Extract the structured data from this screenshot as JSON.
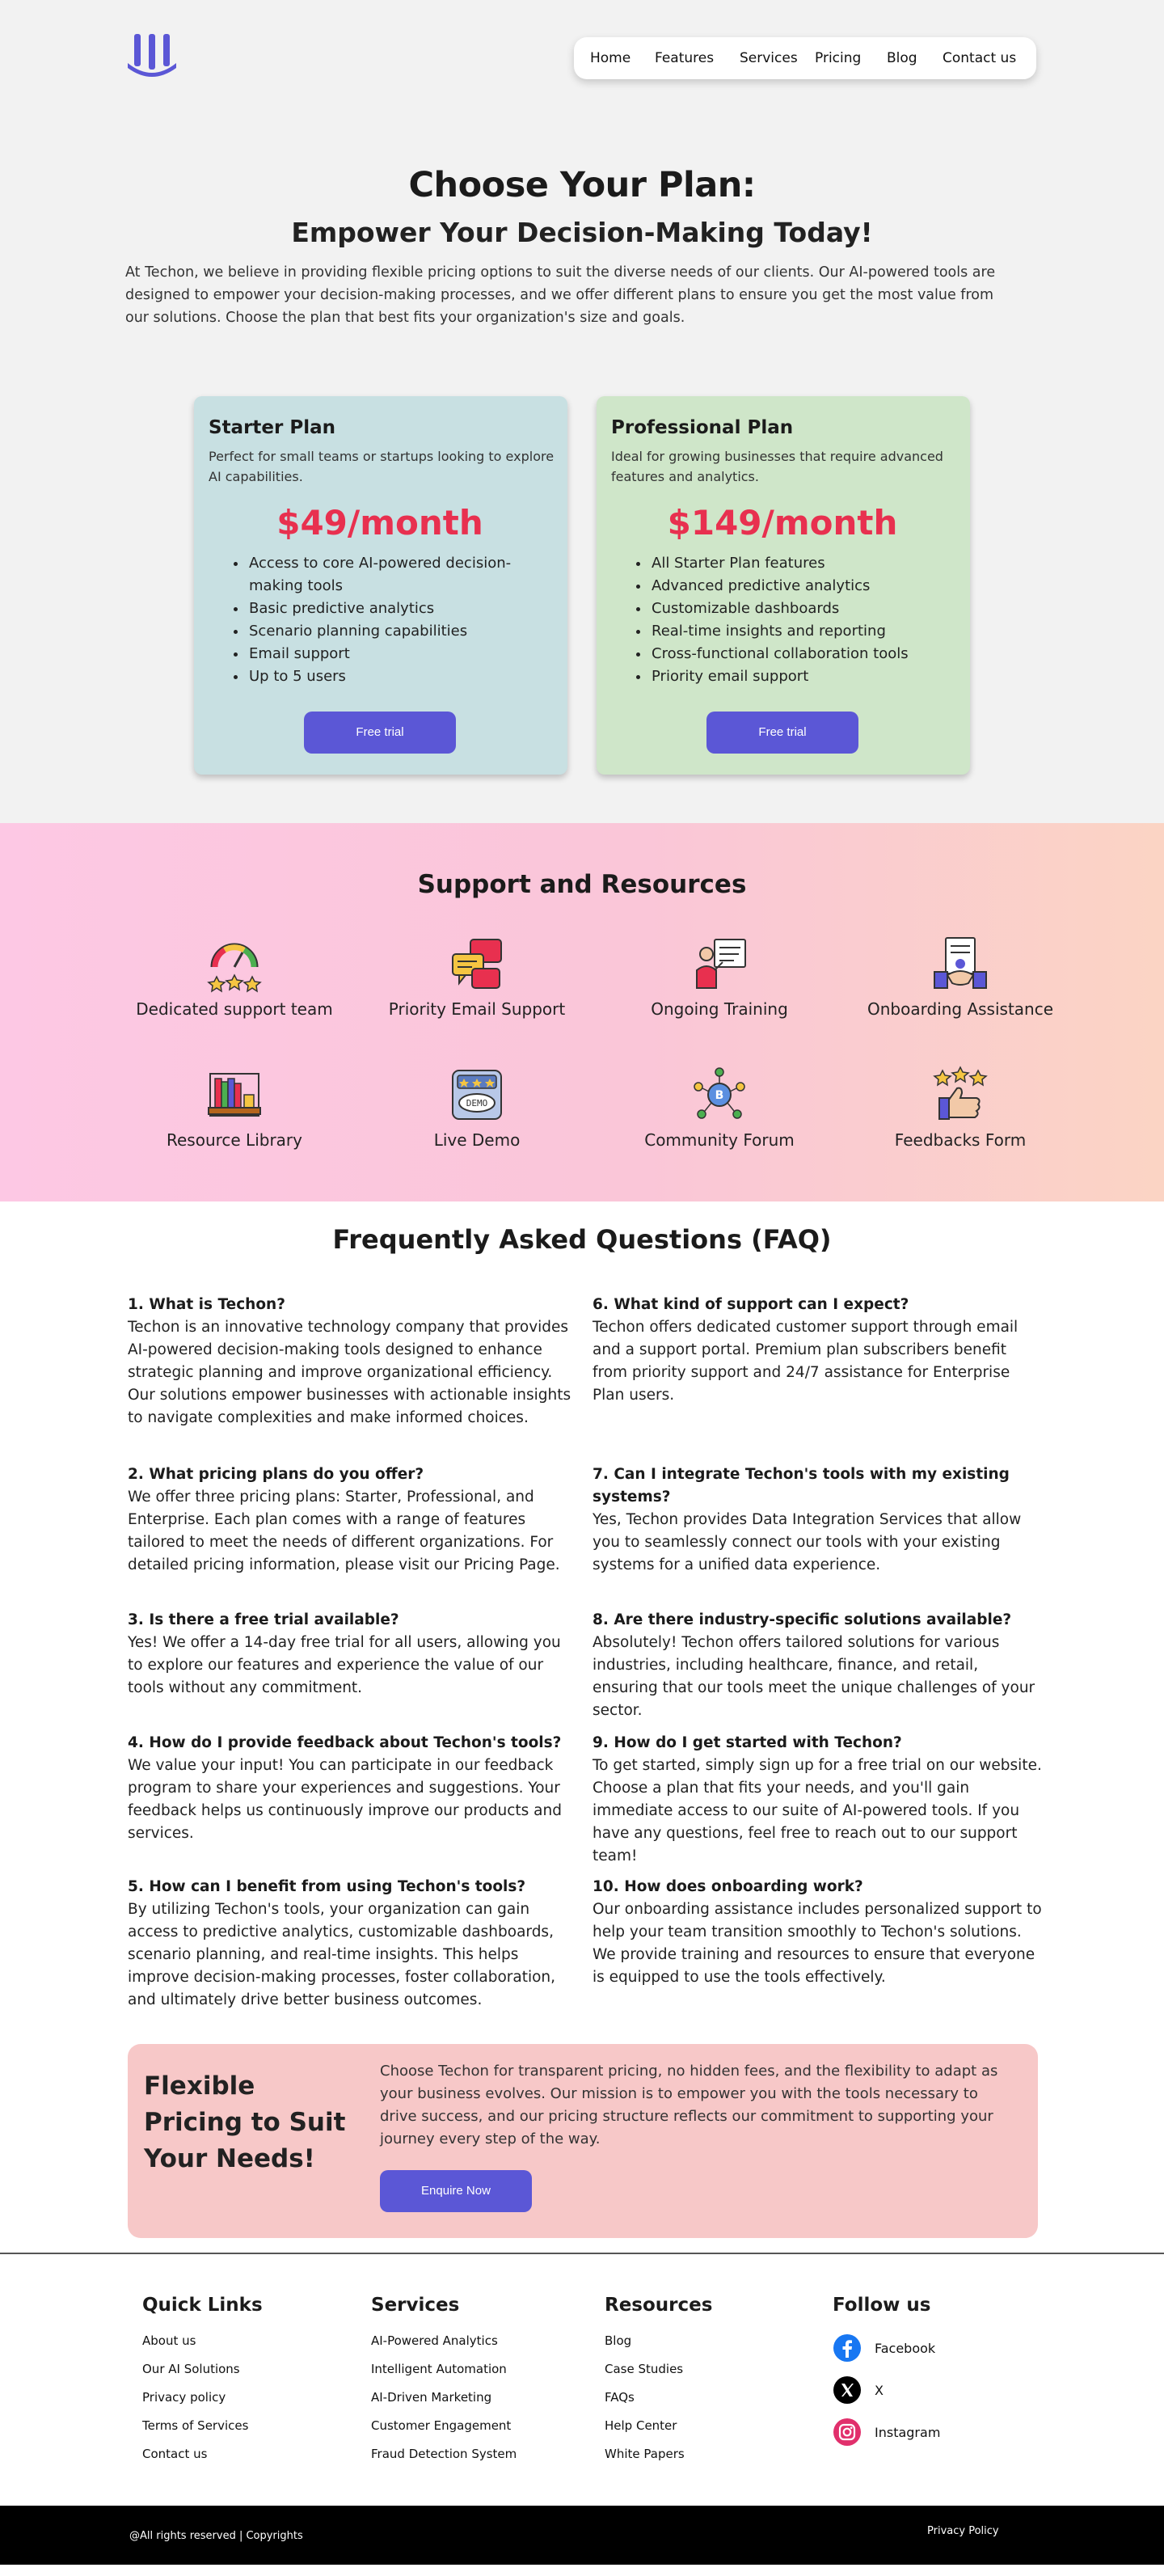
{
  "nav": [
    "Home",
    "Features",
    "Services",
    "Pricing",
    "Blog",
    "Contact us"
  ],
  "hero": {
    "title": "Choose Your Plan:",
    "subtitle": "Empower Your Decision-Making Today!",
    "intro": "At Techon, we believe in providing flexible pricing options to suit the diverse needs of our clients. Our AI-powered tools are designed to empower your decision-making processes, and we offer different plans to ensure you get the most value from our solutions. Choose the plan that best fits your organization's size and goals."
  },
  "plans": [
    {
      "name": "Starter Plan",
      "description": "Perfect for small teams or startups looking to explore AI capabilities.",
      "price": "$49/month",
      "features": [
        "Access to core AI-powered decision-making tools",
        "Basic predictive analytics",
        "Scenario planning capabilities",
        "Email support",
        "Up to 5 users"
      ],
      "button": "Free trial",
      "color": "#c8e0e2"
    },
    {
      "name": "Professional Plan",
      "description": "Ideal for growing businesses that require advanced features and analytics.",
      "price": "$149/month",
      "features": [
        "All Starter Plan features",
        "Advanced predictive analytics",
        "Customizable dashboards",
        "Real-time insights and reporting",
        "Cross-functional collaboration tools",
        "Priority email support"
      ],
      "button": "Free trial",
      "color": "#cfe6c9"
    }
  ],
  "support": {
    "title": "Support and Resources",
    "items": [
      {
        "label": "Dedicated support team",
        "icon": "gauge-stars-icon"
      },
      {
        "label": "Priority Email Support",
        "icon": "chat-bubbles-icon"
      },
      {
        "label": "Ongoing Training",
        "icon": "trainer-board-icon"
      },
      {
        "label": "Onboarding Assistance",
        "icon": "handshake-document-icon"
      },
      {
        "label": "Resource Library",
        "icon": "bookshelf-icon"
      },
      {
        "label": "Live Demo",
        "icon": "demo-screen-icon"
      },
      {
        "label": "Community Forum",
        "icon": "community-network-icon"
      },
      {
        "label": "Feedbacks Form",
        "icon": "thumbs-up-stars-icon"
      }
    ]
  },
  "faq": {
    "title": "Frequently Asked Questions (FAQ)",
    "items": [
      {
        "q": "1. What is Techon?",
        "a": "Techon is an innovative technology company that provides AI-powered decision-making tools designed to enhance strategic planning and improve organizational efficiency. Our solutions empower businesses with actionable insights to navigate complexities and make informed choices."
      },
      {
        "q": "2. What pricing plans do you offer?",
        "a": "We offer three pricing plans: Starter, Professional, and Enterprise. Each plan comes with a range of features tailored to meet the needs of different organizations. For detailed pricing information, please visit our Pricing Page."
      },
      {
        "q": "3. Is there a free trial available?",
        "a": "Yes! We offer a 14-day free trial for all users, allowing you to explore our features and experience the value of our tools without any commitment."
      },
      {
        "q": "4. How do I provide feedback about Techon's tools?",
        "a": "We value your input! You can participate in our feedback program to share your experiences and suggestions. Your feedback helps us continuously improve our products and services."
      },
      {
        "q": "5. How can I benefit from using Techon's tools?",
        "a": "By utilizing Techon's tools, your organization can gain access to predictive analytics, customizable dashboards, scenario planning, and real-time insights. This helps improve decision-making processes, foster collaboration, and ultimately drive better business outcomes."
      },
      {
        "q": "6. What kind of support can I expect?",
        "a": "Techon offers dedicated customer support through email and a support portal. Premium plan subscribers benefit from priority support and 24/7 assistance for Enterprise Plan users."
      },
      {
        "q": "7. Can I integrate Techon's tools with my existing systems?",
        "a": "Yes, Techon provides Data Integration Services that allow you to seamlessly connect our tools with your existing systems for a unified data experience."
      },
      {
        "q": "8. Are there industry-specific solutions available?",
        "a": "Absolutely! Techon offers tailored solutions for various industries, including healthcare, finance, and retail, ensuring that our tools meet the unique challenges of your sector."
      },
      {
        "q": "9. How do I get started with Techon?",
        "a": "To get started, simply sign up for a free trial on our website. Choose a plan that fits your needs, and you'll gain immediate access to our suite of AI-powered tools. If you have any questions, feel free to reach out to our support team!"
      },
      {
        "q": "10. How does onboarding work?",
        "a": "Our onboarding assistance includes personalized support to help your team transition smoothly to Techon's solutions. We provide training and resources to ensure that everyone is equipped to use the tools effectively."
      }
    ]
  },
  "cta": {
    "title": "Flexible Pricing to Suit Your Needs!",
    "text": "Choose Techon for transparent pricing, no hidden fees, and the flexibility to adapt as your business evolves. Our mission is to empower you with the tools necessary to drive success, and our pricing structure reflects our commitment to supporting your journey every step of the way.",
    "button": "Enquire Now"
  },
  "footer": {
    "quick_links": {
      "title": "Quick Links",
      "links": [
        "About us",
        "Our AI Solutions",
        "Privacy policy",
        "Terms of Services",
        "Contact us"
      ]
    },
    "services": {
      "title": "Services",
      "links": [
        "AI-Powered Analytics",
        "Intelligent Automation",
        "AI-Driven Marketing",
        "Customer Engagement",
        "Fraud Detection System"
      ]
    },
    "resources": {
      "title": "Resources",
      "links": [
        "Blog",
        "Case Studies",
        "FAQs",
        "Help Center",
        "White Papers"
      ]
    },
    "follow": {
      "title": "Follow us",
      "links": [
        "Facebook",
        "X",
        "Instagram"
      ]
    },
    "copyright": "@All rights reserved | Copyrights",
    "privacy": "Privacy Policy"
  },
  "colors": {
    "accent": "#5b57d6",
    "price": "#e8304f",
    "logo": "#5b57d6"
  }
}
